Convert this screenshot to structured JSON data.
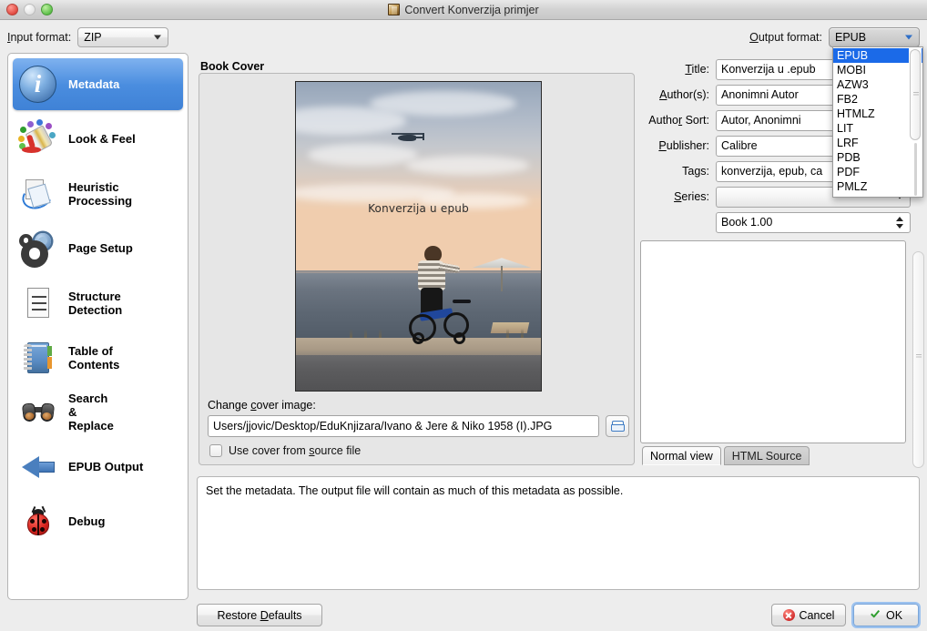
{
  "window": {
    "title": "Convert Konverzija primjer",
    "icon": "book-icon",
    "traffic_lights": [
      "close",
      "minimize",
      "zoom"
    ]
  },
  "top_bar": {
    "input_format_label": "Input format:",
    "input_format_mnemonic": "I",
    "input_format_value": "ZIP",
    "output_format_label": "Output format:",
    "output_format_mnemonic": "O",
    "output_format_value": "EPUB"
  },
  "output_format_dropdown": {
    "open": true,
    "selected": "EPUB",
    "options": [
      "EPUB",
      "MOBI",
      "AZW3",
      "FB2",
      "HTMLZ",
      "LIT",
      "LRF",
      "PDB",
      "PDF",
      "PMLZ"
    ]
  },
  "sidebar": {
    "items": [
      {
        "label": "Metadata",
        "icon": "info-icon",
        "active": true
      },
      {
        "label": "Look & Feel",
        "icon": "paint-bucket-icon",
        "active": false
      },
      {
        "label": "Heuristic Processing",
        "icon": "rotate-pages-icon",
        "active": false
      },
      {
        "label": "Page Setup",
        "icon": "gears-icon",
        "active": false
      },
      {
        "label": "Structure Detection",
        "icon": "document-lines-icon",
        "active": false
      },
      {
        "label": "Table of Contents",
        "icon": "notebook-icon",
        "active": false
      },
      {
        "label": "Search & Replace",
        "icon": "binoculars-icon",
        "active": false
      },
      {
        "label": "EPUB Output",
        "icon": "blue-left-arrow-icon",
        "active": false
      },
      {
        "label": "Debug",
        "icon": "ladybug-icon",
        "active": false
      }
    ]
  },
  "book_cover": {
    "group_title": "Book Cover",
    "cover_overlay_text": "Konverzija u epub",
    "change_cover_label": "Change cover image:",
    "change_cover_mnemonic": "c",
    "cover_path": "Users/jjovic/Desktop/EduKnjizara/Ivano & Jere & Niko 1958 (I).JPG",
    "browse_icon": "folder-icon",
    "use_source_cover_label": "Use cover from source file",
    "use_source_cover_mnemonic": "s",
    "use_source_cover_checked": false
  },
  "metadata": {
    "fields": [
      {
        "label": "Title:",
        "mnemonic": "T",
        "value": "Konverzija u .epub",
        "type": "text"
      },
      {
        "label": "Author(s):",
        "mnemonic": "A",
        "value": "Anonimni Autor",
        "type": "text"
      },
      {
        "label": "Author Sort:",
        "mnemonic": "r",
        "value": "Autor, Anonimni",
        "type": "text"
      },
      {
        "label": "Publisher:",
        "mnemonic": "P",
        "value": "Calibre",
        "type": "text"
      },
      {
        "label": "Tags:",
        "mnemonic": "g",
        "value": "konverzija, epub, ca",
        "type": "text"
      },
      {
        "label": "Series:",
        "mnemonic": "S",
        "value": "",
        "type": "combo"
      }
    ],
    "series_index_value": "Book 1.00",
    "comments_value": "",
    "tabs": [
      {
        "label": "Normal view",
        "active": true
      },
      {
        "label": "HTML Source",
        "active": false
      }
    ]
  },
  "status": {
    "message": "Set the metadata. The output file will contain as much of this metadata as possible."
  },
  "footer": {
    "restore_defaults_label": "Restore Defaults",
    "restore_defaults_mnemonic": "D",
    "cancel_label": "Cancel",
    "cancel_icon": "red-x-icon",
    "ok_label": "OK",
    "ok_icon": "green-check-icon"
  },
  "colors": {
    "accent_blue": "#1b6ae8",
    "sidebar_active": "#4a8ddf",
    "window_bg": "#ededed",
    "cancel_red": "#d32f2f",
    "ok_green": "#2f9e2f"
  }
}
